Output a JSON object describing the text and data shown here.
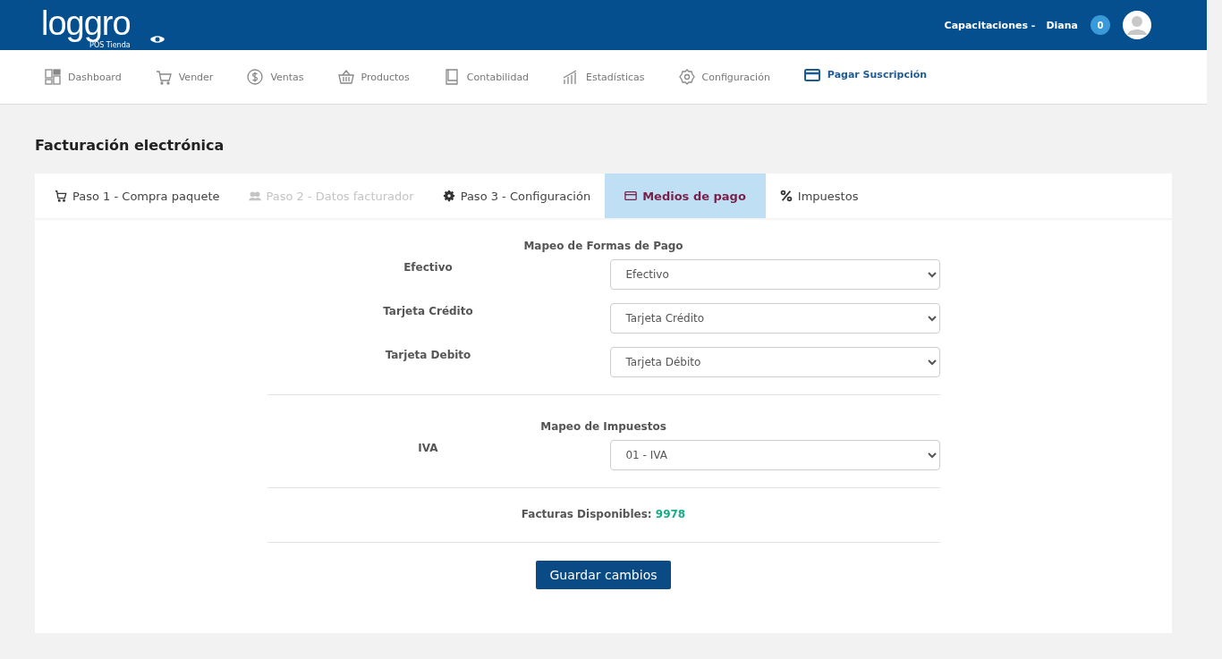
{
  "header": {
    "logo": "loggro",
    "logo_sub": "POS Tienda",
    "company": "Capacitaciones -",
    "user": "Diana",
    "notifications": "0"
  },
  "nav": [
    {
      "label": "Dashboard",
      "kind": "dashboard",
      "selected": false
    },
    {
      "label": "Vender",
      "kind": "cart",
      "selected": false
    },
    {
      "label": "Ventas",
      "kind": "dollar",
      "selected": false
    },
    {
      "label": "Productos",
      "kind": "basket",
      "selected": false
    },
    {
      "label": "Contabilidad",
      "kind": "book",
      "selected": false
    },
    {
      "label": "Estadísticas",
      "kind": "chart",
      "selected": false
    },
    {
      "label": "Configuración",
      "kind": "gear",
      "selected": false
    },
    {
      "label": "Pagar Suscripción",
      "kind": "card",
      "selected": true
    }
  ],
  "page_title": "Facturación electrónica",
  "tabs": [
    {
      "label": "Paso 1 - Compra paquete",
      "kind": "cart",
      "selected": false,
      "disabled": false
    },
    {
      "label": "Paso 2 - Datos facturador",
      "kind": "users",
      "selected": false,
      "disabled": true
    },
    {
      "label": "Paso 3 - Configuración",
      "kind": "gear",
      "selected": false,
      "disabled": false
    },
    {
      "label": "Medios de pago",
      "kind": "card",
      "selected": true,
      "disabled": false
    },
    {
      "label": "Impuestos",
      "kind": "percent",
      "selected": false,
      "disabled": false
    }
  ],
  "payment_section": {
    "title": "Mapeo de Formas de Pago",
    "rows": [
      {
        "label": "Efectivo",
        "value": "Efectivo"
      },
      {
        "label": "Tarjeta Crédito",
        "value": "Tarjeta Crédito"
      },
      {
        "label": "Tarjeta Debito",
        "value": "Tarjeta Débito"
      }
    ]
  },
  "tax_section": {
    "title": "Mapeo de Impuestos",
    "rows": [
      {
        "label": "IVA",
        "value": "01 - IVA"
      }
    ]
  },
  "available": {
    "label": "Facturas Disponibles:",
    "value": "9978"
  },
  "save_button": "Guardar cambios"
}
